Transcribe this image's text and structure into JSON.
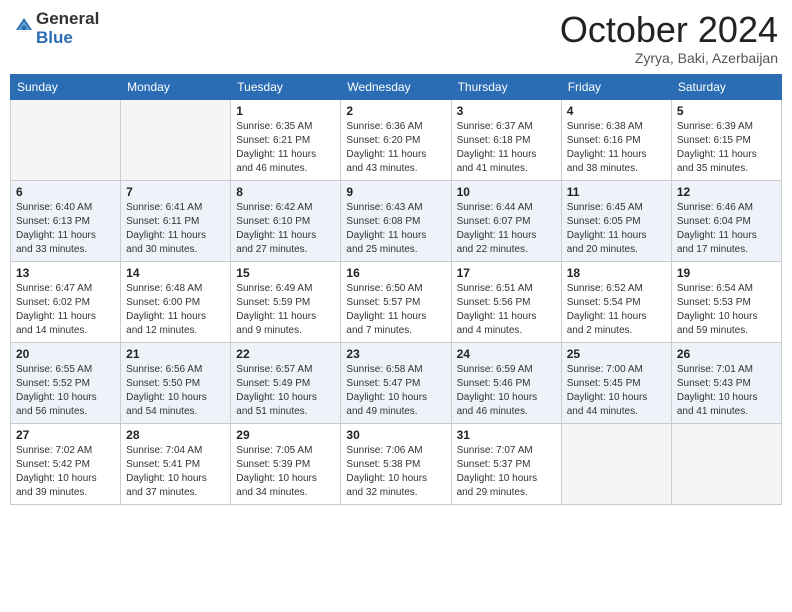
{
  "header": {
    "logo_general": "General",
    "logo_blue": "Blue",
    "month_title": "October 2024",
    "location": "Zyrya, Baki, Azerbaijan"
  },
  "days_of_week": [
    "Sunday",
    "Monday",
    "Tuesday",
    "Wednesday",
    "Thursday",
    "Friday",
    "Saturday"
  ],
  "weeks": [
    [
      {
        "day": "",
        "info": ""
      },
      {
        "day": "",
        "info": ""
      },
      {
        "day": "1",
        "info": "Sunrise: 6:35 AM\nSunset: 6:21 PM\nDaylight: 11 hours and 46 minutes."
      },
      {
        "day": "2",
        "info": "Sunrise: 6:36 AM\nSunset: 6:20 PM\nDaylight: 11 hours and 43 minutes."
      },
      {
        "day": "3",
        "info": "Sunrise: 6:37 AM\nSunset: 6:18 PM\nDaylight: 11 hours and 41 minutes."
      },
      {
        "day": "4",
        "info": "Sunrise: 6:38 AM\nSunset: 6:16 PM\nDaylight: 11 hours and 38 minutes."
      },
      {
        "day": "5",
        "info": "Sunrise: 6:39 AM\nSunset: 6:15 PM\nDaylight: 11 hours and 35 minutes."
      }
    ],
    [
      {
        "day": "6",
        "info": "Sunrise: 6:40 AM\nSunset: 6:13 PM\nDaylight: 11 hours and 33 minutes."
      },
      {
        "day": "7",
        "info": "Sunrise: 6:41 AM\nSunset: 6:11 PM\nDaylight: 11 hours and 30 minutes."
      },
      {
        "day": "8",
        "info": "Sunrise: 6:42 AM\nSunset: 6:10 PM\nDaylight: 11 hours and 27 minutes."
      },
      {
        "day": "9",
        "info": "Sunrise: 6:43 AM\nSunset: 6:08 PM\nDaylight: 11 hours and 25 minutes."
      },
      {
        "day": "10",
        "info": "Sunrise: 6:44 AM\nSunset: 6:07 PM\nDaylight: 11 hours and 22 minutes."
      },
      {
        "day": "11",
        "info": "Sunrise: 6:45 AM\nSunset: 6:05 PM\nDaylight: 11 hours and 20 minutes."
      },
      {
        "day": "12",
        "info": "Sunrise: 6:46 AM\nSunset: 6:04 PM\nDaylight: 11 hours and 17 minutes."
      }
    ],
    [
      {
        "day": "13",
        "info": "Sunrise: 6:47 AM\nSunset: 6:02 PM\nDaylight: 11 hours and 14 minutes."
      },
      {
        "day": "14",
        "info": "Sunrise: 6:48 AM\nSunset: 6:00 PM\nDaylight: 11 hours and 12 minutes."
      },
      {
        "day": "15",
        "info": "Sunrise: 6:49 AM\nSunset: 5:59 PM\nDaylight: 11 hours and 9 minutes."
      },
      {
        "day": "16",
        "info": "Sunrise: 6:50 AM\nSunset: 5:57 PM\nDaylight: 11 hours and 7 minutes."
      },
      {
        "day": "17",
        "info": "Sunrise: 6:51 AM\nSunset: 5:56 PM\nDaylight: 11 hours and 4 minutes."
      },
      {
        "day": "18",
        "info": "Sunrise: 6:52 AM\nSunset: 5:54 PM\nDaylight: 11 hours and 2 minutes."
      },
      {
        "day": "19",
        "info": "Sunrise: 6:54 AM\nSunset: 5:53 PM\nDaylight: 10 hours and 59 minutes."
      }
    ],
    [
      {
        "day": "20",
        "info": "Sunrise: 6:55 AM\nSunset: 5:52 PM\nDaylight: 10 hours and 56 minutes."
      },
      {
        "day": "21",
        "info": "Sunrise: 6:56 AM\nSunset: 5:50 PM\nDaylight: 10 hours and 54 minutes."
      },
      {
        "day": "22",
        "info": "Sunrise: 6:57 AM\nSunset: 5:49 PM\nDaylight: 10 hours and 51 minutes."
      },
      {
        "day": "23",
        "info": "Sunrise: 6:58 AM\nSunset: 5:47 PM\nDaylight: 10 hours and 49 minutes."
      },
      {
        "day": "24",
        "info": "Sunrise: 6:59 AM\nSunset: 5:46 PM\nDaylight: 10 hours and 46 minutes."
      },
      {
        "day": "25",
        "info": "Sunrise: 7:00 AM\nSunset: 5:45 PM\nDaylight: 10 hours and 44 minutes."
      },
      {
        "day": "26",
        "info": "Sunrise: 7:01 AM\nSunset: 5:43 PM\nDaylight: 10 hours and 41 minutes."
      }
    ],
    [
      {
        "day": "27",
        "info": "Sunrise: 7:02 AM\nSunset: 5:42 PM\nDaylight: 10 hours and 39 minutes."
      },
      {
        "day": "28",
        "info": "Sunrise: 7:04 AM\nSunset: 5:41 PM\nDaylight: 10 hours and 37 minutes."
      },
      {
        "day": "29",
        "info": "Sunrise: 7:05 AM\nSunset: 5:39 PM\nDaylight: 10 hours and 34 minutes."
      },
      {
        "day": "30",
        "info": "Sunrise: 7:06 AM\nSunset: 5:38 PM\nDaylight: 10 hours and 32 minutes."
      },
      {
        "day": "31",
        "info": "Sunrise: 7:07 AM\nSunset: 5:37 PM\nDaylight: 10 hours and 29 minutes."
      },
      {
        "day": "",
        "info": ""
      },
      {
        "day": "",
        "info": ""
      }
    ]
  ]
}
